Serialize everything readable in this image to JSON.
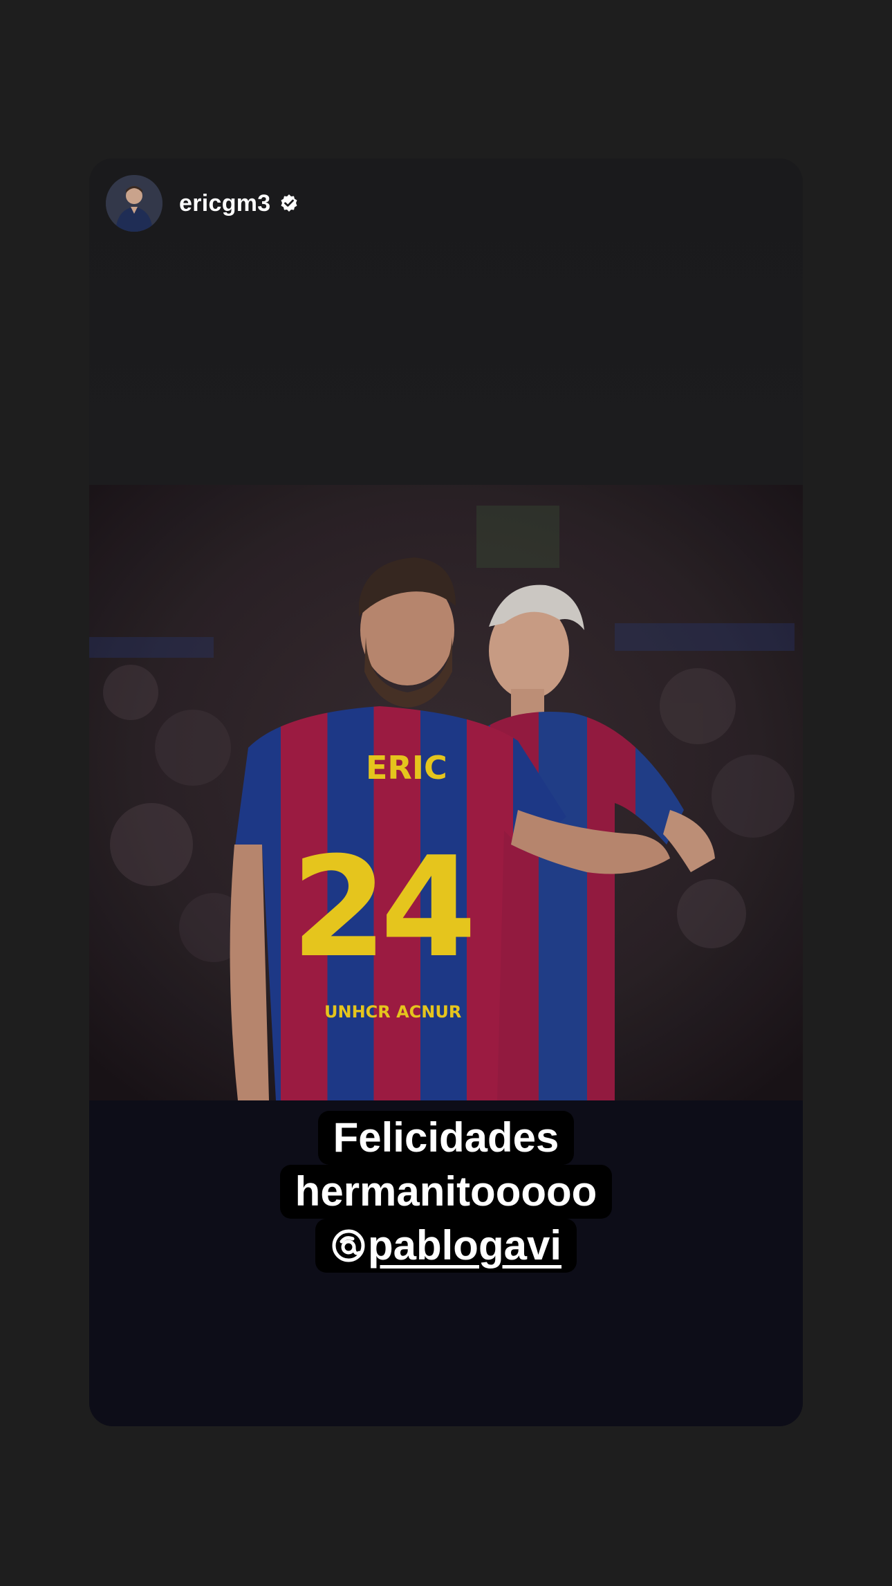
{
  "story": {
    "username": "ericgm3",
    "verified": true,
    "avatar_icon": "avatar-photo",
    "photo_description": "Two football players in blue and red striped jerseys embracing on the pitch",
    "jersey_name": "ERIC",
    "jersey_number": "24",
    "jersey_patch": "UNHCR ACNUR",
    "caption": {
      "line1": "Felicidades",
      "line2": "hermanitooooo",
      "mention_handle": "pablogavi",
      "mention_icon": "threads-icon"
    }
  },
  "colors": {
    "background": "#1e1e1e",
    "story_bottom": "#0d0d18",
    "caption_bg": "#000000",
    "caption_text": "#ffffff",
    "jersey_blue": "#1f3c8f",
    "jersey_red": "#a51d46",
    "jersey_yellow": "#f4d21f"
  }
}
